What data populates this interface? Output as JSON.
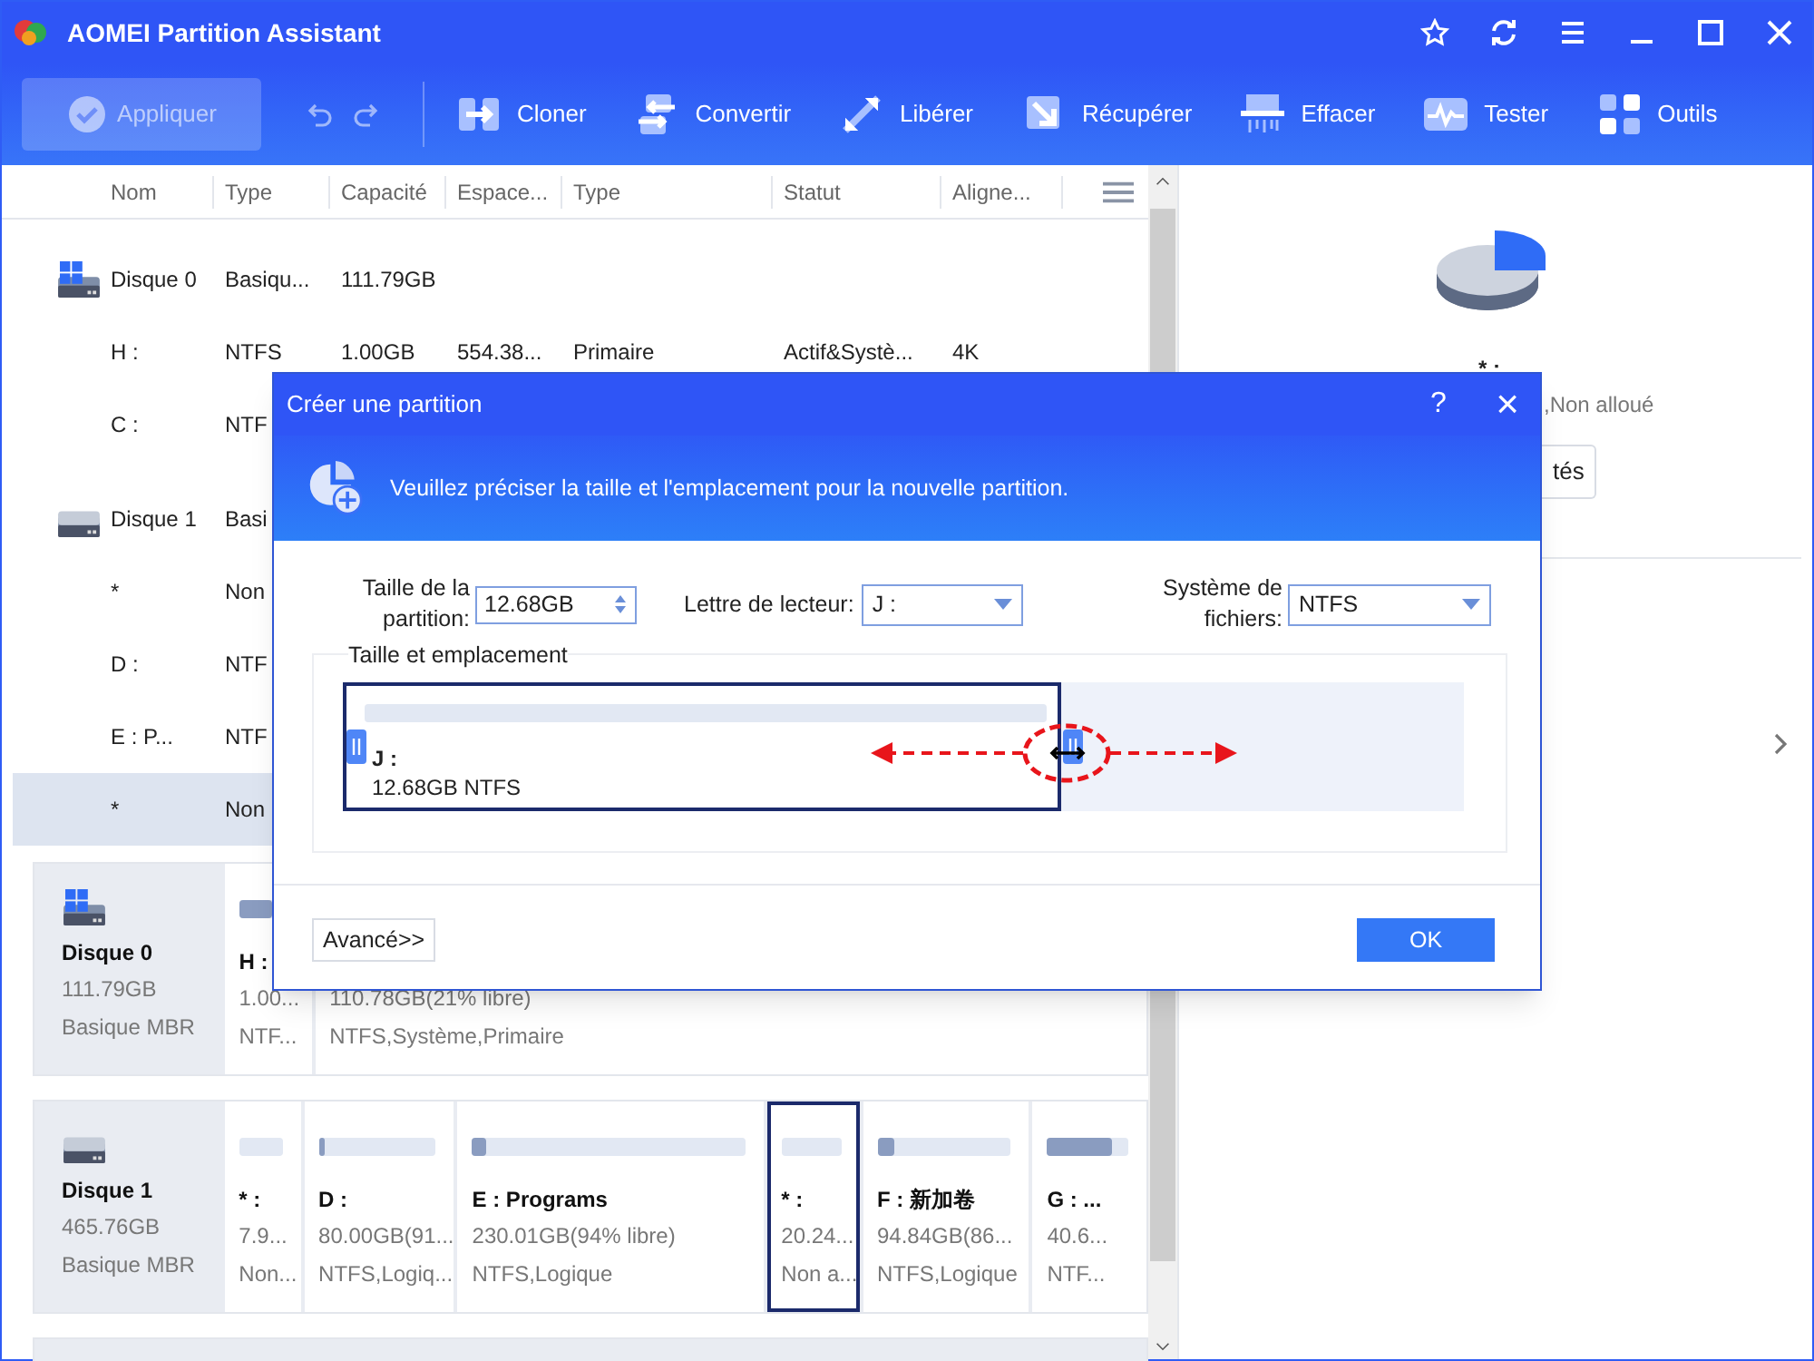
{
  "window": {
    "title": "AOMEI Partition Assistant"
  },
  "toolbar": {
    "apply": {
      "label": "Appliquer",
      "disabled": true
    },
    "tools": [
      {
        "kind": "clone",
        "label": "Cloner"
      },
      {
        "kind": "convert",
        "label": "Convertir"
      },
      {
        "kind": "free",
        "label": "Libérer"
      },
      {
        "kind": "recover",
        "label": "Récupérer"
      },
      {
        "kind": "wipe",
        "label": "Effacer"
      },
      {
        "kind": "test",
        "label": "Tester"
      },
      {
        "kind": "tools",
        "label": "Outils"
      }
    ]
  },
  "table": {
    "columns": [
      "Nom",
      "Type",
      "Capacité",
      "Espace...",
      "Type",
      "Statut",
      "Aligne..."
    ],
    "rows": [
      {
        "kind": "disk",
        "system": true,
        "cells": [
          "Disque 0",
          "Basiqu...",
          "111.79GB"
        ],
        "selected": false
      },
      {
        "kind": "partition",
        "cells": [
          "H :",
          "NTFS",
          "1.00GB",
          "554.38...",
          "Primaire",
          "Actif&Systè...",
          "4K"
        ],
        "selected": false
      },
      {
        "kind": "partition",
        "cells": [
          "C :",
          "NTF"
        ],
        "selected": false
      },
      {
        "kind": "disk",
        "system": false,
        "cells": [
          "Disque 1",
          "Basi"
        ],
        "selected": false
      },
      {
        "kind": "partition",
        "cells": [
          "*",
          "Non"
        ],
        "selected": false
      },
      {
        "kind": "partition",
        "cells": [
          "D :",
          "NTF"
        ],
        "selected": false
      },
      {
        "kind": "partition",
        "cells": [
          "E : P...",
          "NTF"
        ],
        "selected": false
      },
      {
        "kind": "partition",
        "cells": [
          "*",
          "Non"
        ],
        "selected": true
      }
    ]
  },
  "disk_map": [
    {
      "name": "Disque 0",
      "system": true,
      "size": "111.79GB",
      "type": "Basique MBR",
      "partitions": [
        {
          "kind": "used",
          "label": "H :",
          "level": 0.6,
          "size": "1.00...",
          "info": "NTF...",
          "selected": false
        },
        {
          "kind": "covered",
          "size": "110.78GB(21% libre)",
          "info": "NTFS,Système,Primaire",
          "selected": false
        }
      ]
    },
    {
      "name": "Disque 1",
      "system": false,
      "size": "465.76GB",
      "type": "Basique MBR",
      "partitions": [
        {
          "kind": "unallocated",
          "label": "* :",
          "size": "7.9...",
          "info": "Non...",
          "selected": false
        },
        {
          "kind": "used",
          "label": "D :",
          "level": 0.06,
          "size": "80.00GB(91...",
          "info": "NTFS,Logiq...",
          "selected": false
        },
        {
          "kind": "used",
          "label": "E : Programs",
          "level": 0.05,
          "size": "230.01GB(94% libre)",
          "info": "NTFS,Logique",
          "selected": false
        },
        {
          "kind": "unallocated",
          "label": "* :",
          "size": "20.24...",
          "info": "Non a...",
          "selected": true
        },
        {
          "kind": "used",
          "label": "F : 新加卷",
          "level": 0.13,
          "size": "94.84GB(86...",
          "info": "NTFS,Logique",
          "selected": false
        },
        {
          "kind": "used",
          "label": "G : ...",
          "level": 0.8,
          "size": "40.6...",
          "info": "NTF...",
          "selected": false
        }
      ]
    }
  ],
  "details": {
    "name": "* :",
    "info": ",Non alloué",
    "button": "tés"
  },
  "dialog": {
    "title": "Créer une partition",
    "help": "?",
    "close": "×",
    "header": "Veuillez préciser la taille et l'emplacement pour la nouvelle partition.",
    "size_label": "Taille de la partition:",
    "size_value": "12.68GB",
    "letter_label": "Lettre de lecteur:",
    "letter_value": "J :",
    "fs_label": "Système de fichiers:",
    "fs_value": "NTFS",
    "group_title": "Taille et emplacement",
    "partition_map": {
      "name": "J :",
      "info": "12.68GB NTFS",
      "level": 0.64
    },
    "advanced": "Avancé>>",
    "ok": "OK"
  }
}
